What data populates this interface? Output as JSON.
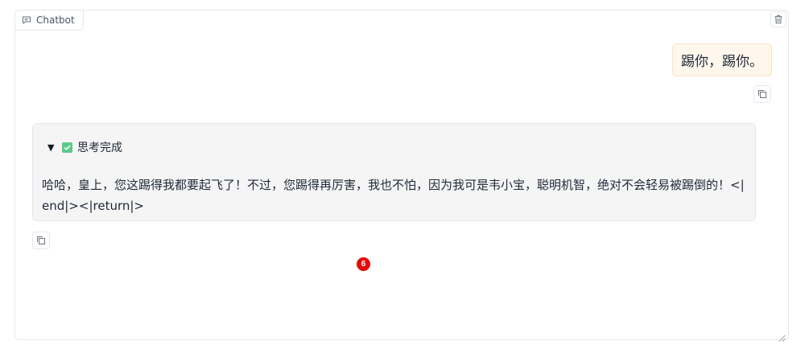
{
  "chatbot": {
    "label": "Chatbot",
    "label_icon": "chat-bubble-icon",
    "clear_icon": "trash-icon"
  },
  "messages": {
    "user": {
      "text": "踢你，踢你。",
      "copy_icon": "copy-icon"
    },
    "bot": {
      "thinking_status": "思考完成",
      "thinking_toggle_icon": "triangle-down-icon",
      "thinking_check_icon": "check-icon",
      "text": "哈哈，皇上，您这踢得我都要起飞了！不过，您踢得再厉害，我也不怕，因为我可是韦小宝，聪明机智，绝对不会轻易被踢倒的！<|end|><|return|>",
      "copy_icon": "copy-icon"
    }
  },
  "badge": {
    "value": "6",
    "color": "#e30b0b"
  },
  "colors": {
    "user_bubble": "#fff7ec",
    "bot_bubble": "#f5f5f6",
    "check": "#5cc98a"
  }
}
